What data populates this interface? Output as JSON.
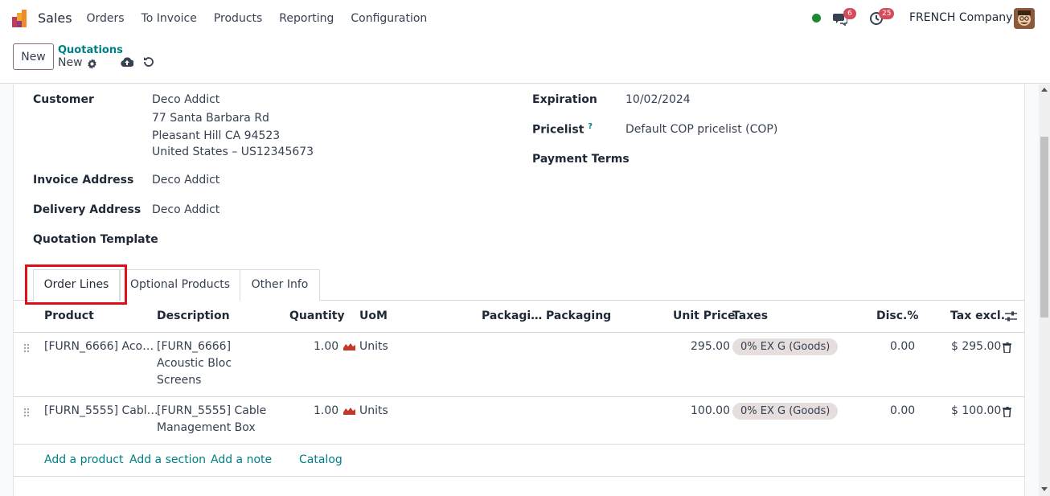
{
  "navbar": {
    "app_name": "Sales",
    "menu": [
      "Orders",
      "To Invoice",
      "Products",
      "Reporting",
      "Configuration"
    ],
    "messages_count": "6",
    "activities_count": "25",
    "company": "FRENCH Company"
  },
  "control": {
    "new_label": "New",
    "breadcrumb": "Quotations",
    "record_title": "New"
  },
  "form": {
    "customer_label": "Customer",
    "customer_lines": [
      "Deco Addict",
      "77 Santa Barbara Rd",
      "Pleasant Hill CA 94523",
      "United States – US12345673"
    ],
    "invoice_address_label": "Invoice Address",
    "invoice_address": "Deco Addict",
    "delivery_address_label": "Delivery Address",
    "delivery_address": "Deco Addict",
    "quotation_template_label": "Quotation Template",
    "expiration_label": "Expiration",
    "expiration": "10/02/2024",
    "pricelist_label": "Pricelist",
    "pricelist_help": "?",
    "pricelist": "Default COP pricelist (COP)",
    "payment_terms_label": "Payment Terms"
  },
  "tabs": [
    "Order Lines",
    "Optional Products",
    "Other Info"
  ],
  "table": {
    "headers": {
      "product": "Product",
      "description": "Description",
      "quantity": "Quantity",
      "uom": "UoM",
      "packaging_qty": "Packagi…",
      "packaging": "Packaging",
      "unit_price": "Unit Price",
      "taxes": "Taxes",
      "discount": "Disc.%",
      "subtotal": "Tax excl."
    },
    "rows": [
      {
        "product": "[FURN_6666] Aco…",
        "description": [
          "[FURN_6666]",
          "Acoustic Bloc",
          "Screens"
        ],
        "quantity": "1.00",
        "uom": "Units",
        "unit_price": "295.00",
        "tax": "0% EX G (Goods)",
        "discount": "0.00",
        "subtotal": "$ 295.00"
      },
      {
        "product": "[FURN_5555] Cabl…",
        "description": [
          "[FURN_5555] Cable",
          "Management Box"
        ],
        "quantity": "1.00",
        "uom": "Units",
        "unit_price": "100.00",
        "tax": "0% EX G (Goods)",
        "discount": "0.00",
        "subtotal": "$ 100.00"
      }
    ],
    "actions": [
      "Add a product",
      "Add a section",
      "Add a note",
      "Catalog"
    ]
  },
  "colors": {
    "accent": "#017e84",
    "badge": "#d44c59",
    "highlight": "#e0101a",
    "tax_tag": "#e6dddd"
  }
}
